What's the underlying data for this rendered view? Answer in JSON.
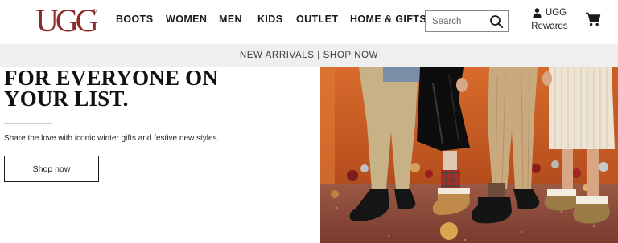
{
  "brand": {
    "logo_text": "UGG"
  },
  "nav": {
    "items": [
      {
        "label": "BOOTS"
      },
      {
        "label": "WOMEN"
      },
      {
        "label": "MEN"
      },
      {
        "label": "KIDS"
      },
      {
        "label": "OUTLET"
      },
      {
        "label": "HOME & GIFTS"
      }
    ]
  },
  "search": {
    "placeholder": "Search",
    "icon": "search-icon"
  },
  "rewards": {
    "line1": "UGG",
    "line2": "Rewards",
    "icon": "user-icon"
  },
  "cart": {
    "icon": "cart-icon"
  },
  "promo": {
    "text": "NEW ARRIVALS | SHOP NOW"
  },
  "hero": {
    "title_line1": "FOR EVERYONE ON",
    "title_line2": "YOUR LIST.",
    "subtitle": "Share the love with iconic winter gifts and festive new styles.",
    "button_label": "Shop now"
  },
  "colors": {
    "brand": "#8b2a2a",
    "text": "#1a1a1a",
    "promo_bg": "#efefef",
    "hero_backdrop": "#c8612a"
  }
}
